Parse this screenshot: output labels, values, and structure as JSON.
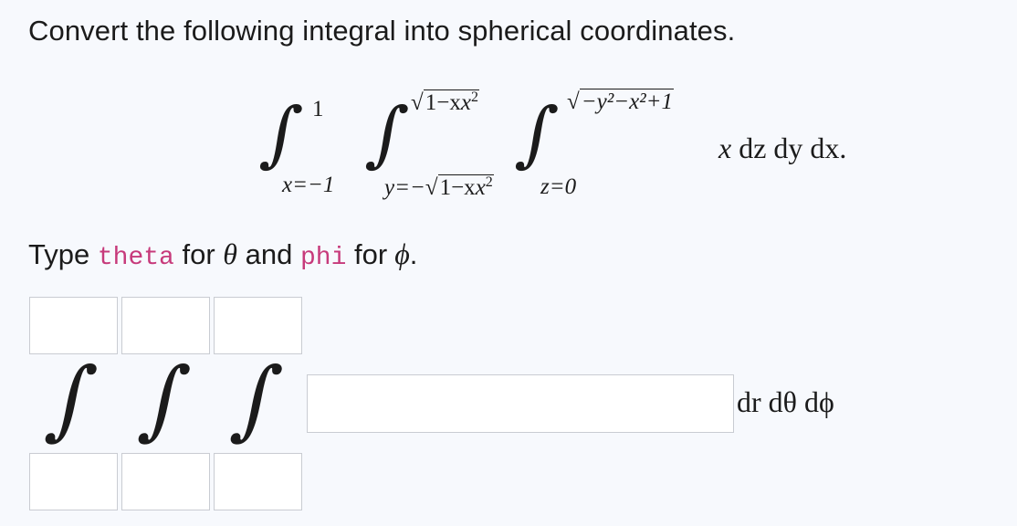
{
  "prompt": "Convert the following integral into spherical coordinates.",
  "integral": {
    "outer": {
      "upper": "1",
      "lower": "x=−1"
    },
    "middle": {
      "upper_radicand": "1−x",
      "lower_prefix": "y=−",
      "lower_radicand": "1−x"
    },
    "inner": {
      "upper_radicand": "−y²−x²+1",
      "lower": "z=0"
    },
    "integrand": {
      "var": "x",
      "differentials": "dz dy dx."
    }
  },
  "instruction": {
    "text_type": "Type",
    "theta_code": "theta",
    "text_for1": "for",
    "theta_symbol": "θ",
    "text_and": "and",
    "phi_code": "phi",
    "text_for2": "for",
    "phi_symbol": "ϕ",
    "period": "."
  },
  "answer": {
    "upper_limits": [
      "",
      "",
      ""
    ],
    "lower_limits": [
      "",
      "",
      ""
    ],
    "integrand_value": "",
    "differentials": "dr dθ dϕ"
  }
}
